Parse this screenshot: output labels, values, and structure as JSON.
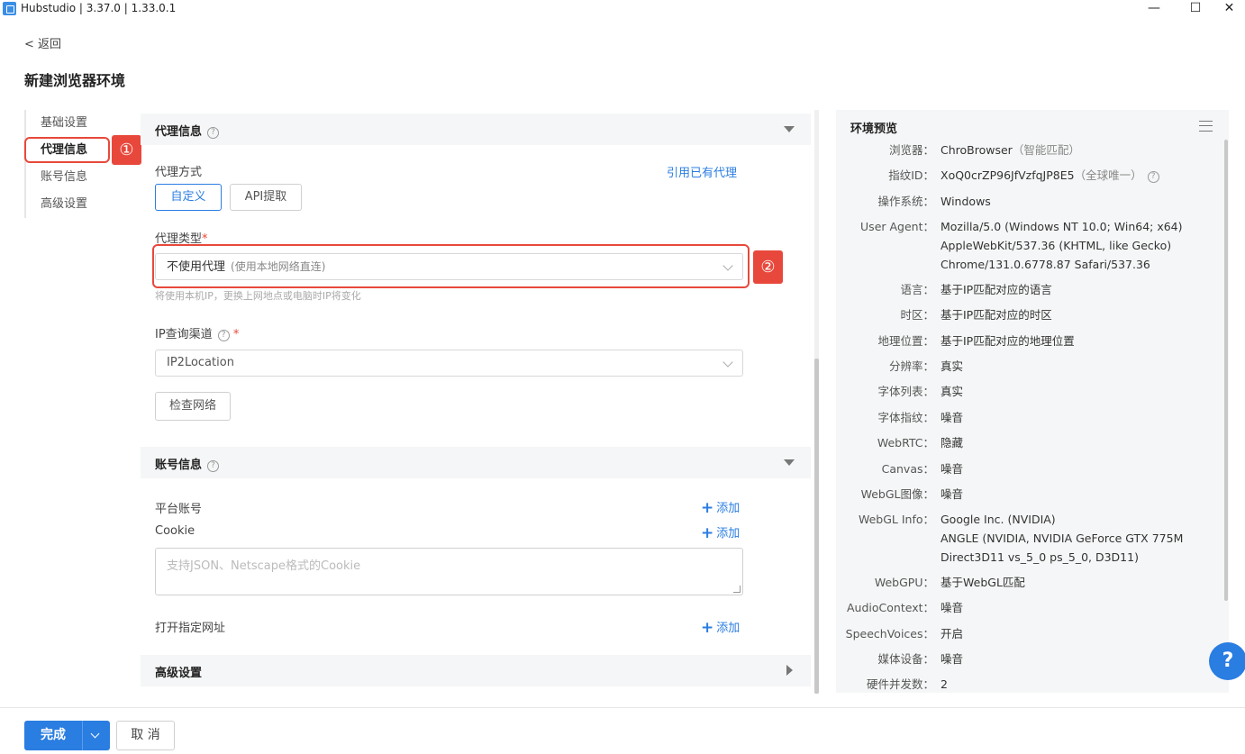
{
  "window": {
    "title": "Hubstudio | 3.37.0 | 1.33.0.1",
    "minimize": "—",
    "maximize": "☐",
    "close": "✕"
  },
  "header": {
    "back": "< 返回",
    "title": "新建浏览器环境"
  },
  "nav": {
    "items": [
      "基础设置",
      "代理信息",
      "账号信息",
      "高级设置"
    ],
    "active": "代理信息"
  },
  "badges": {
    "one": "①",
    "two": "②"
  },
  "proxy": {
    "section_title": "代理信息",
    "method_label": "代理方式",
    "method_options": [
      "自定义",
      "API提取"
    ],
    "selected_method": "自定义",
    "use_existing_link": "引用已有代理",
    "type_label": "代理类型",
    "type_value": "不使用代理",
    "type_hint": "(使用本地网络直连)",
    "type_note": "将使用本机IP，更换上网地点或电脑时IP将变化",
    "ip_channel_label": "IP查询渠道",
    "ip_channel_value": "IP2Location",
    "check_button": "检查网络"
  },
  "account": {
    "section_title": "账号信息",
    "platform_label": "平台账号",
    "cookie_label": "Cookie",
    "add_label": "添加",
    "cookie_placeholder": "支持JSON、Netscape格式的Cookie",
    "open_url_label": "打开指定网址"
  },
  "advanced": {
    "section_title": "高级设置"
  },
  "preview": {
    "title": "环境预览",
    "rows": [
      {
        "k": "浏览器：",
        "v": "ChroBrowser",
        "sub": "（智能匹配）"
      },
      {
        "k": "指纹ID：",
        "v": "XoQ0crZP96JfVzfqJP8E5",
        "sub": "（全球唯一）"
      },
      {
        "k": "操作系统：",
        "v": "Windows"
      },
      {
        "k": "User Agent：",
        "v": "Mozilla/5.0 (Windows NT 10.0; Win64; x64)",
        "v2": "AppleWebKit/537.36 (KHTML, like Gecko)",
        "v3": "Chrome/131.0.6778.87 Safari/537.36"
      },
      {
        "k": "语言：",
        "v": "基于IP匹配对应的语言"
      },
      {
        "k": "时区：",
        "v": "基于IP匹配对应的时区"
      },
      {
        "k": "地理位置：",
        "v": "基于IP匹配对应的地理位置"
      },
      {
        "k": "分辨率：",
        "v": "真实"
      },
      {
        "k": "字体列表：",
        "v": "真实"
      },
      {
        "k": "字体指纹：",
        "v": "噪音"
      },
      {
        "k": "WebRTC：",
        "v": "隐藏"
      },
      {
        "k": "Canvas：",
        "v": "噪音"
      },
      {
        "k": "WebGL图像：",
        "v": "噪音"
      },
      {
        "k": "WebGL Info：",
        "v": "Google Inc. (NVIDIA)",
        "v2": "ANGLE (NVIDIA, NVIDIA GeForce GTX 775M",
        "v3": "Direct3D11 vs_5_0 ps_5_0, D3D11)"
      },
      {
        "k": "WebGPU：",
        "v": "基于WebGL匹配"
      },
      {
        "k": "AudioContext：",
        "v": "噪音"
      },
      {
        "k": "SpeechVoices：",
        "v": "开启"
      },
      {
        "k": "媒体设备：",
        "v": "噪音"
      },
      {
        "k": "硬件并发数：",
        "v": "2"
      }
    ]
  },
  "help_float": "?",
  "footer": {
    "done": "完成",
    "cancel": "取 消"
  }
}
